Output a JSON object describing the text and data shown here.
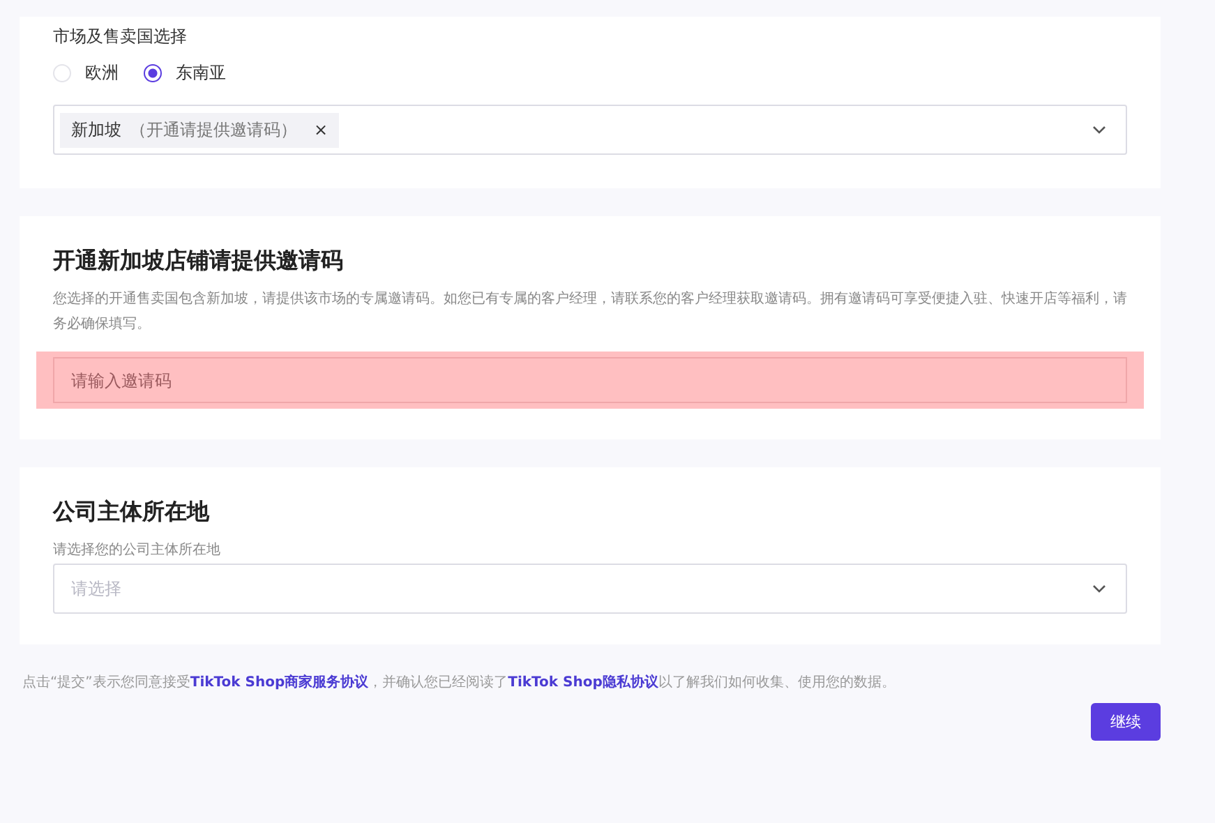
{
  "market": {
    "label": "市场及售卖国选择",
    "regions": [
      {
        "label": "欧洲",
        "selected": false
      },
      {
        "label": "东南亚",
        "selected": true
      }
    ],
    "countries": [
      {
        "name": "新加坡",
        "note": "（开通请提供邀请码）",
        "remove": "×"
      }
    ]
  },
  "invite": {
    "title": "开通新加坡店铺请提供邀请码",
    "description": "您选择的开通售卖国包含新加坡，请提供该市场的专属邀请码。如您已有专属的客户经理，请联系您的客户经理获取邀请码。拥有邀请码可享受便捷入驻、快速开店等福利，请务必确保填写。",
    "placeholder": "请输入邀请码",
    "highlighted": true
  },
  "company": {
    "title": "公司主体所在地",
    "description": "请选择您的公司主体所在地",
    "placeholder": "请选择"
  },
  "agreement": [
    {
      "kind": "text",
      "text": "点击“提交”表示您同意接受"
    },
    {
      "kind": "link",
      "text": "TikTok Shop商家服务协议"
    },
    {
      "kind": "text",
      "text": "，并确认您已经阅读了"
    },
    {
      "kind": "link",
      "text": "TikTok Shop隐私协议"
    },
    {
      "kind": "text",
      "text": "以了解我们如何收集、使用您的数据。"
    }
  ],
  "continue_button": "继续"
}
